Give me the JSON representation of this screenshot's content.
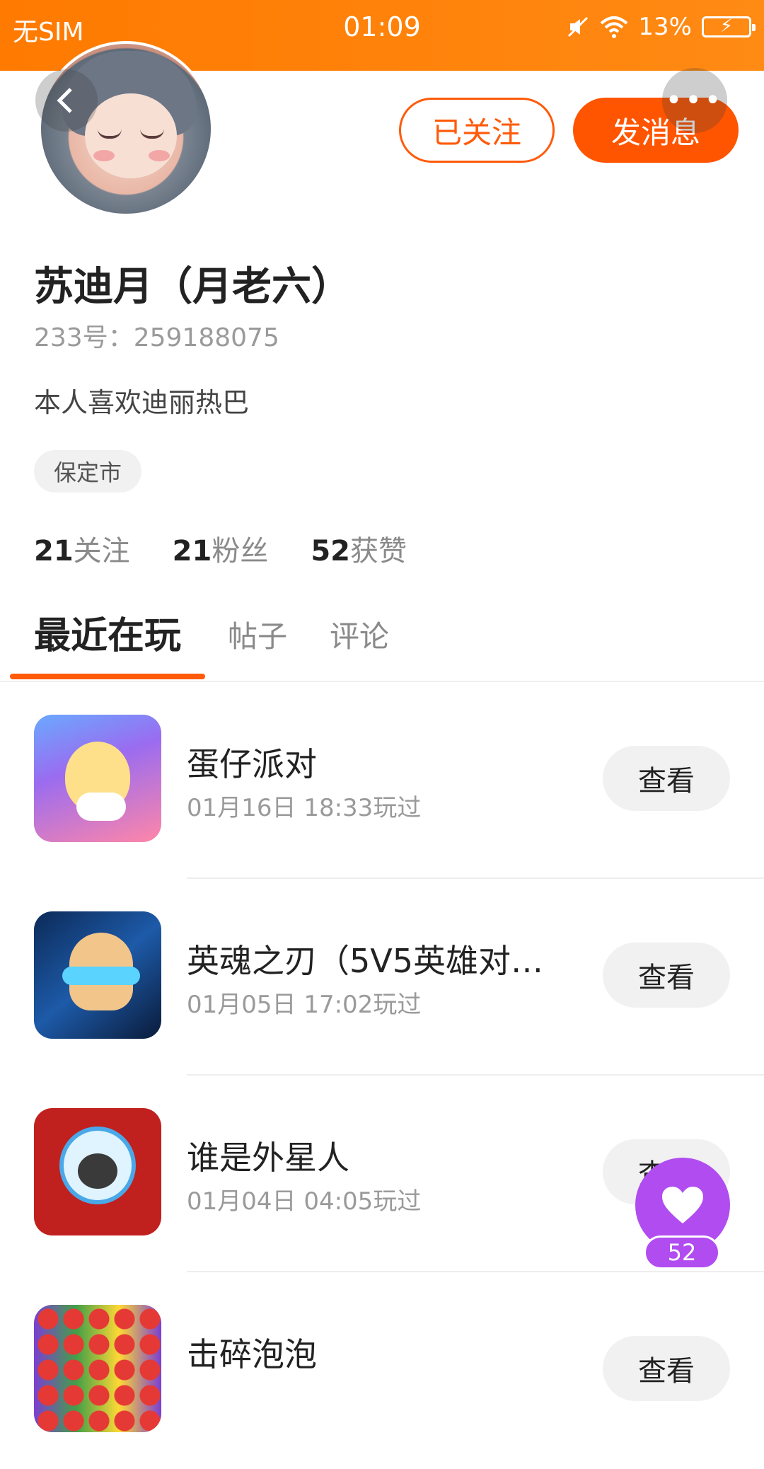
{
  "status_bar": {
    "carrier": "无SIM",
    "time": "01:09",
    "battery_percent": "13%"
  },
  "header": {
    "follow_button": "已关注",
    "message_button": "发消息",
    "more_icon": "more-icon",
    "back_icon": "back-icon"
  },
  "profile": {
    "name": "苏迪月（月老六）",
    "uid": "233号：259188075",
    "bio": "本人喜欢迪丽热巴",
    "location": "保定市",
    "stats": [
      {
        "num": "21",
        "label": "关注"
      },
      {
        "num": "21",
        "label": "粉丝"
      },
      {
        "num": "52",
        "label": "获赞"
      }
    ]
  },
  "tabs": [
    {
      "label": "最近在玩",
      "active": true
    },
    {
      "label": "帖子",
      "active": false
    },
    {
      "label": "评论",
      "active": false
    }
  ],
  "games": [
    {
      "title": "蛋仔派对",
      "time": "01月16日 18:33玩过",
      "button": "查看",
      "icon": "egg-party-icon"
    },
    {
      "title": "英魂之刃（5V5英雄对…",
      "time": "01月05日 17:02玩过",
      "button": "查看",
      "icon": "soul-blade-icon"
    },
    {
      "title": "谁是外星人",
      "time": "01月04日 04:05玩过",
      "button": "查看",
      "icon": "alien-game-icon"
    },
    {
      "title": "击碎泡泡",
      "time": "",
      "button": "查看",
      "icon": "bubble-game-icon"
    }
  ],
  "like_fab": {
    "count": "52",
    "icon": "heart-icon"
  },
  "colors": {
    "accent": "#ff5500",
    "status_bar": "#ff7a00",
    "like": "#b04cf0"
  }
}
